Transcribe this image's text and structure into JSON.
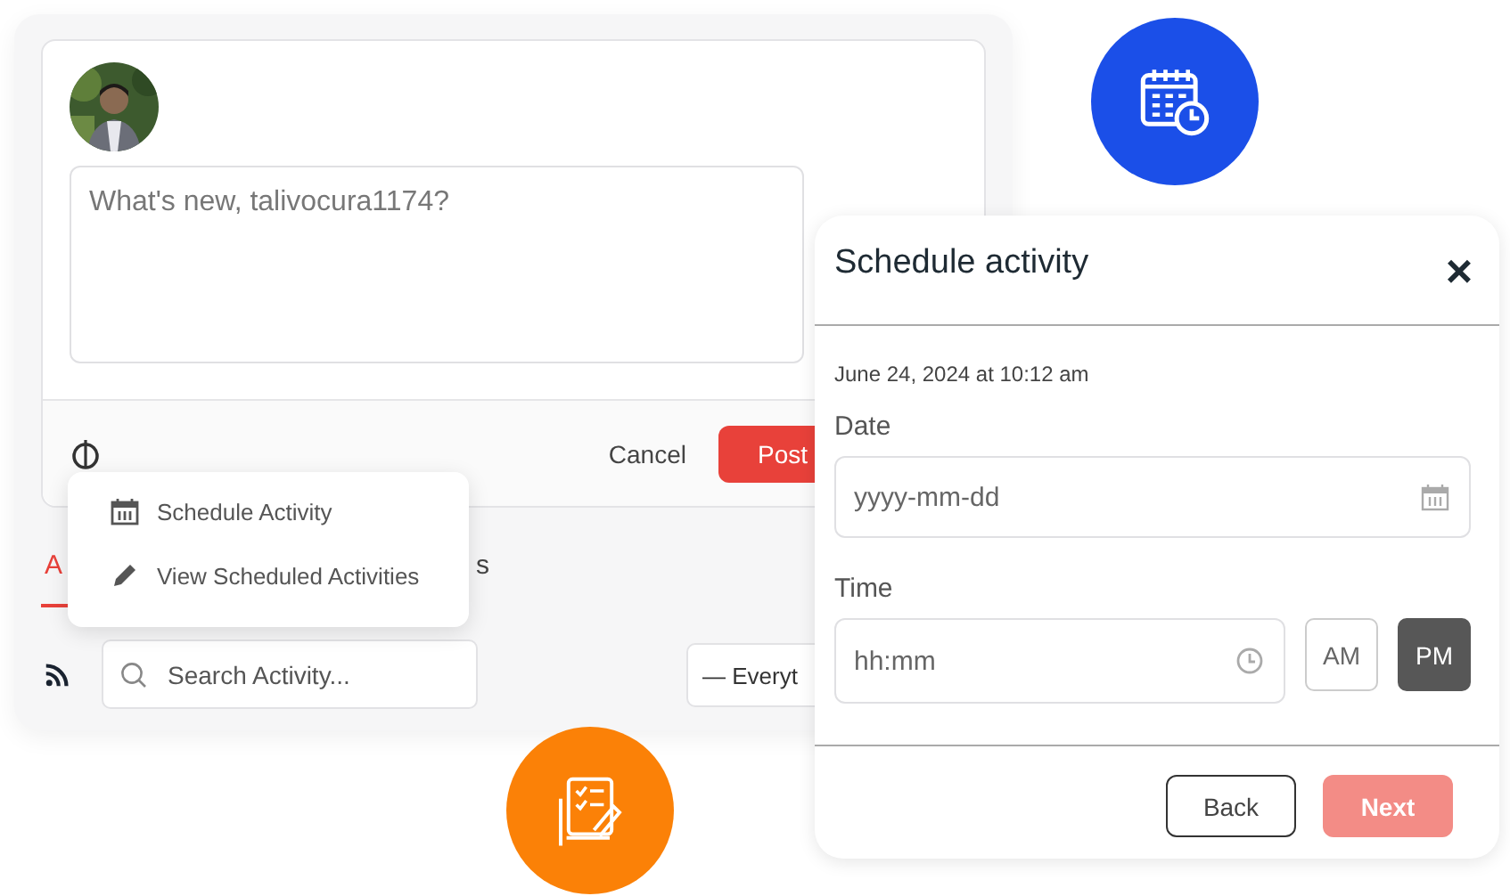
{
  "composer": {
    "placeholder": "What's new, talivocura1174?",
    "cancel": "Cancel",
    "post": "Post"
  },
  "menu": {
    "items": [
      {
        "label": "Schedule Activity",
        "kind": "calendar"
      },
      {
        "label": "View Scheduled Activities",
        "kind": "pencil"
      }
    ]
  },
  "tabs": [
    {
      "label": "A",
      "selected": true
    },
    {
      "label": "s",
      "selected": false
    }
  ],
  "search": {
    "placeholder": "Search Activity..."
  },
  "filter": {
    "value": "— Everyt"
  },
  "modal": {
    "title": "Schedule activity",
    "close": "×",
    "timestamp": "June 24, 2024 at 10:12 am",
    "date": {
      "label": "Date",
      "placeholder": "yyyy-mm-dd"
    },
    "time": {
      "label": "Time",
      "placeholder": "hh:mm"
    },
    "meridiem": [
      {
        "label": "AM",
        "selected": false
      },
      {
        "label": "PM",
        "selected": true
      }
    ],
    "back": "Back",
    "next": {
      "label": "Next",
      "disabled": true
    }
  }
}
